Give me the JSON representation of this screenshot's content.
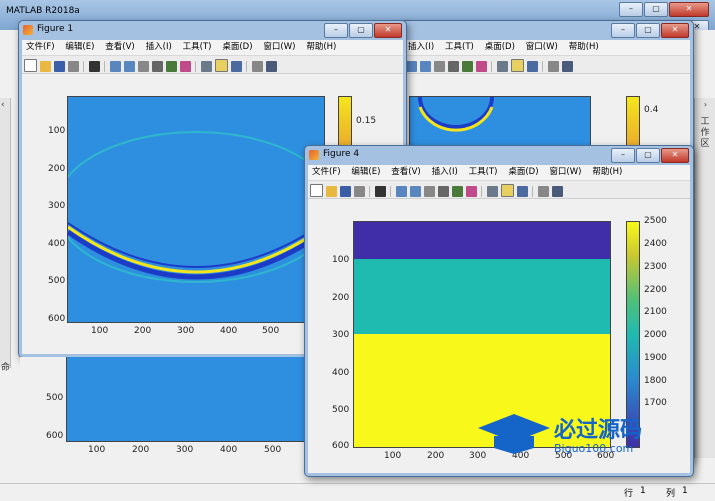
{
  "app": {
    "title": "MATLAB R2018a"
  },
  "menus": [
    "文件(F)",
    "编辑(E)",
    "查看(V)",
    "插入(I)",
    "工具(T)",
    "桌面(D)",
    "窗口(W)",
    "帮助(H)"
  ],
  "figure1": {
    "title": "Figure 1",
    "yticks": [
      "100",
      "200",
      "300",
      "400",
      "500",
      "600"
    ],
    "xticks": [
      "100",
      "200",
      "300",
      "400",
      "500"
    ],
    "colorbar_ticks": [
      "0.15"
    ]
  },
  "figure2": {
    "colorbar_ticks": [
      "0.4"
    ],
    "yticks": [
      "500",
      "600"
    ],
    "xticks": [
      "100",
      "200",
      "300",
      "400",
      "500"
    ]
  },
  "figure4": {
    "title": "Figure 4",
    "yticks": [
      "100",
      "200",
      "300",
      "400",
      "500",
      "600"
    ],
    "xticks": [
      "100",
      "200",
      "300",
      "400",
      "500",
      "600"
    ],
    "colorbar_ticks": [
      "2500",
      "2400",
      "2300",
      "2200",
      "2100",
      "2000",
      "1900",
      "1800",
      "1700"
    ],
    "layers": [
      {
        "color": "#3f2ea8",
        "value": 1650
      },
      {
        "color": "#1fbab0",
        "value": 2000
      },
      {
        "color": "#f8f91a",
        "value": 2500
      }
    ]
  },
  "side_panel": {
    "right_label": "工作区",
    "left_label": "命"
  },
  "status": {
    "row_label": "行",
    "row_value": "1",
    "col_label": "列",
    "col_value": "1"
  },
  "watermark": {
    "text": "必过源码",
    "url": "Biguo100.com"
  },
  "colors": {
    "field_blue": "#2e8fe0",
    "dark_blue": "#1c3cc8",
    "yellow": "#f5e51b",
    "cyan": "#30c0c8"
  }
}
